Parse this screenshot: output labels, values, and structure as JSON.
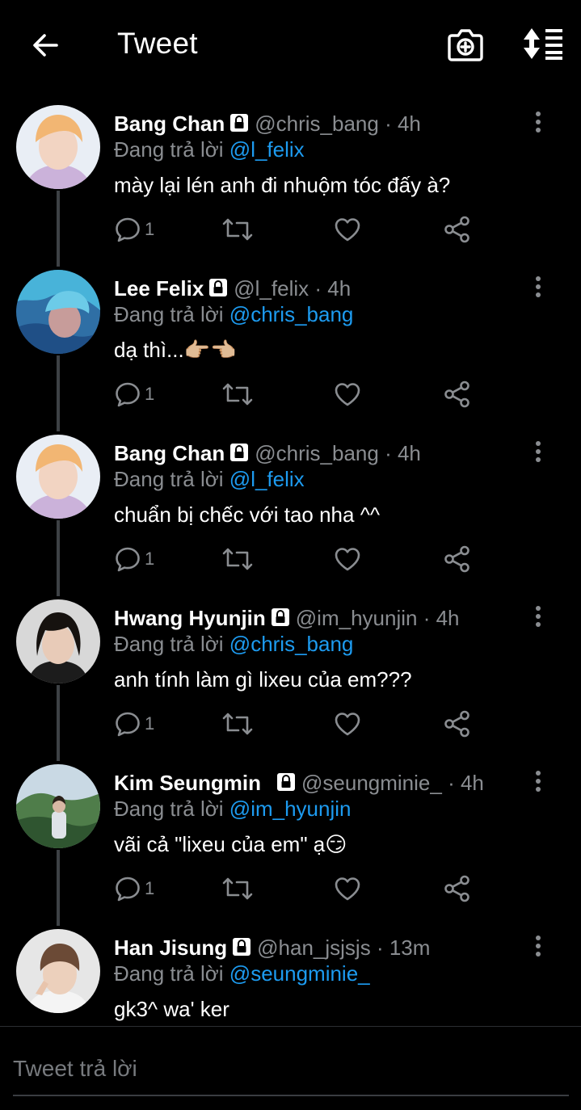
{
  "app": {
    "title": "Tweet"
  },
  "header": {
    "title": "Tweet",
    "back_icon": "arrow-left-icon",
    "camera_icon": "camera-plus-icon",
    "sort_icon": "sort-icon"
  },
  "labels": {
    "replying_prefix": "Đang trả lời"
  },
  "colors": {
    "background": "#000000",
    "accent": "#1d9bf0",
    "muted": "#8a8d91",
    "connector": "#3d4145"
  },
  "tweets": [
    {
      "name": "Bang Chan",
      "handle": "@chris_bang",
      "time": "· 4h",
      "replying_to": "@l_felix",
      "text": "mày lại lén anh đi nhuộm tóc đấy à?",
      "reply_count": "1",
      "avatar": "blonde-hair-avatar"
    },
    {
      "name": "Lee Felix",
      "handle": "@l_felix",
      "time": "· 4h",
      "replying_to": "@chris_bang",
      "text": "dạ thì...👉🏼👈🏼",
      "reply_count": "1",
      "avatar": "blue-hair-avatar"
    },
    {
      "name": "Bang Chan",
      "handle": "@chris_bang",
      "time": "· 4h",
      "replying_to": "@l_felix",
      "text": "chuẩn bị chếc với tao nha ^^",
      "reply_count": "1",
      "avatar": "blonde-hair-avatar"
    },
    {
      "name": "Hwang Hyunjin",
      "handle": "@im_hyunjin",
      "time": "· 4h",
      "replying_to": "@chris_bang",
      "text": "anh tính làm gì lixeu của em???",
      "reply_count": "1",
      "avatar": "dark-hair-avatar"
    },
    {
      "name": "Kim Seungmin",
      "handle": "@seungminie_",
      "time": "· 4h",
      "replying_to": "@im_hyunjin",
      "text": "vãi cả \"lixeu của em\" ạ😏",
      "reply_count": "1",
      "avatar": "landscape-avatar"
    },
    {
      "name": "Han Jisung",
      "handle": "@han_jsjsjs",
      "time": "· 13m",
      "replying_to": "@seungminie_",
      "text": "gk3^ wa' ker",
      "reply_count": "",
      "avatar": "brown-hair-avatar"
    }
  ],
  "reply_box": {
    "placeholder": "Tweet trả lời"
  }
}
